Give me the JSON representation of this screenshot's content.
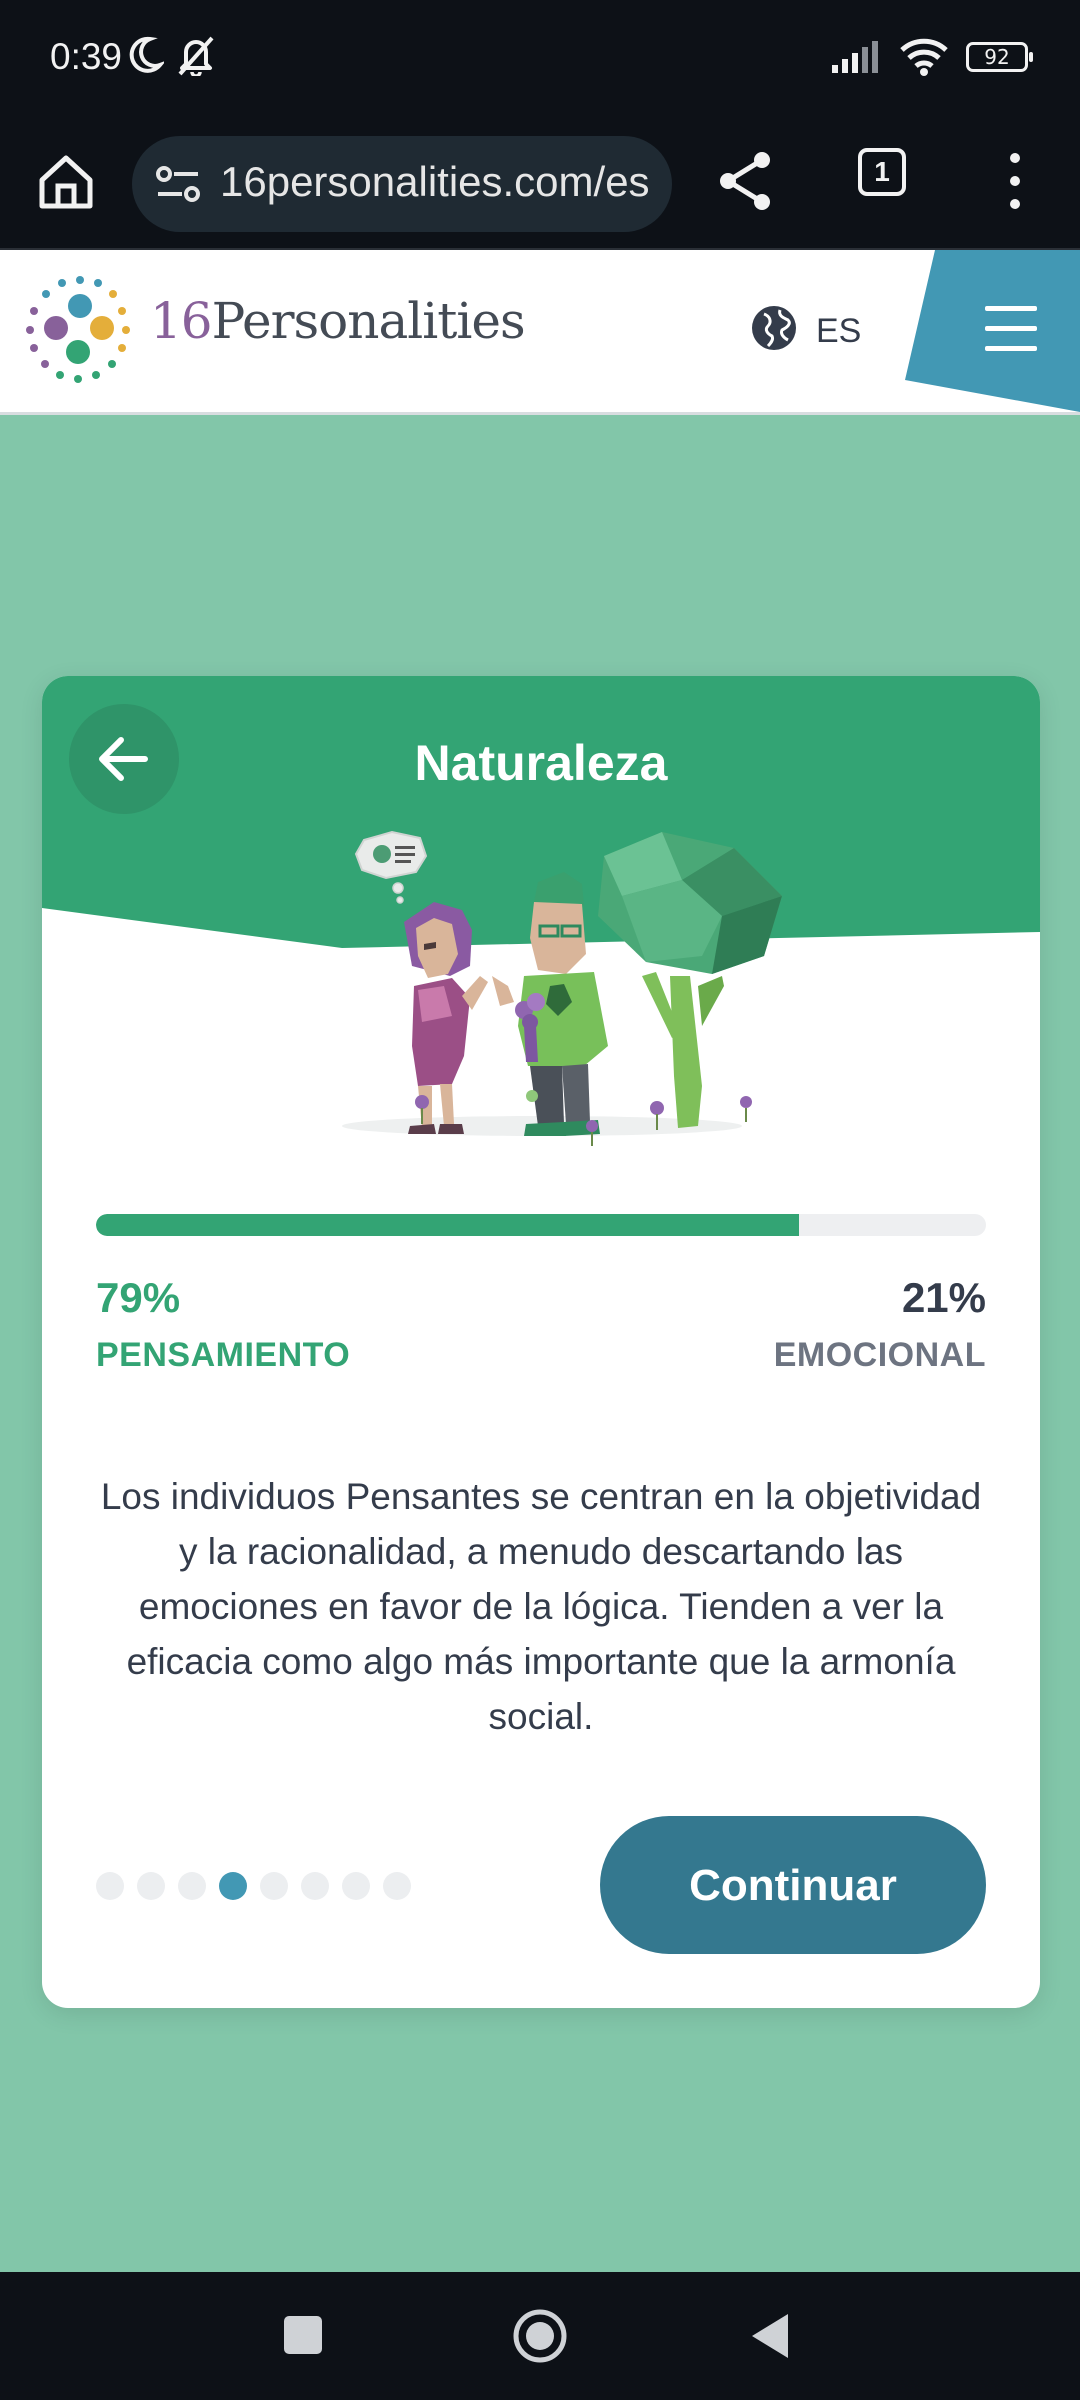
{
  "status_bar": {
    "time": "0:39",
    "battery": "92"
  },
  "browser": {
    "url": "16personalities.com/es",
    "tab_count": "1"
  },
  "header": {
    "logo_number": "16",
    "logo_word": "Personalities",
    "language": "ES"
  },
  "card": {
    "title": "Naturaleza",
    "progress_fraction": 0.79,
    "left_percent": "79%",
    "left_label": "PENSAMIENTO",
    "right_percent": "21%",
    "right_label": "EMOCIONAL",
    "description": "Los individuos Pensantes se centran en la objetividad y la racionalidad, a menudo descartando las emociones en favor de la lógica. Tienden a ver la eficacia como algo más importante que la armonía social.",
    "pager_total": 8,
    "pager_active_index": 3,
    "continue_label": "Continuar"
  },
  "colors": {
    "accent_green": "#33a474",
    "page_background": "#82c6a9",
    "button_teal": "#34788f",
    "active_dot": "#4298b4"
  }
}
